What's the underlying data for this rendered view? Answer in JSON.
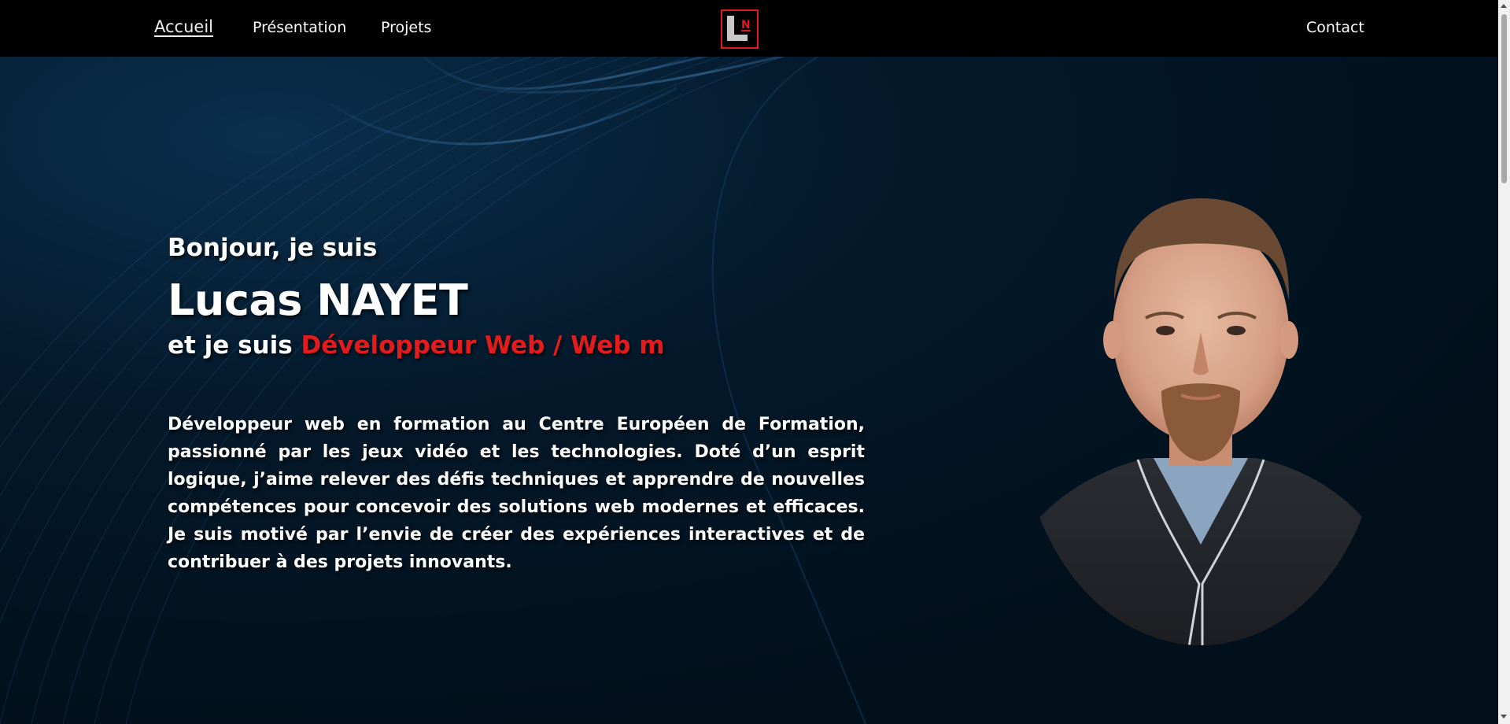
{
  "nav": {
    "links": [
      {
        "label": "Accueil",
        "active": true
      },
      {
        "label": "Présentation",
        "active": false
      },
      {
        "label": "Projets",
        "active": false
      }
    ],
    "contact_label": "Contact",
    "logo": {
      "letter_main": "L",
      "letter_small": "N"
    }
  },
  "hero": {
    "greeting": "Bonjour, je suis",
    "name": "Lucas NAYET",
    "role_prefix": "et je suis ",
    "role_highlight": "Développeur Web / Web m",
    "bio": "Développeur web en formation au Centre Européen de Formation, passionné par les jeux vidéo et les technologies. Doté d’un esprit logique, j’aime relever des défis techniques et apprendre de nouvelles compétences pour concevoir des solutions web modernes et efficaces. Je suis motivé par l’envie de créer des expériences interactives et de contribuer à des projets innovants."
  },
  "colors": {
    "accent": "#e51b1b",
    "nav_background": "#000000",
    "hero_background": "#021320",
    "text": "#ffffff"
  },
  "icons": {
    "logo": "ln-monogram-logo",
    "portrait": "profile-photo"
  }
}
